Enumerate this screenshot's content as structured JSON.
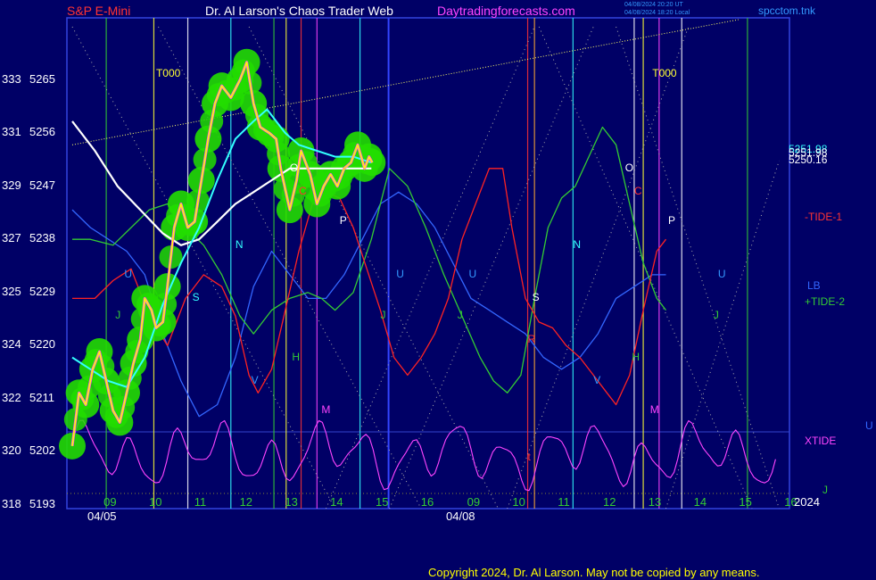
{
  "header": {
    "symbol": "S&P E-Mini",
    "author": "Dr. Al Larson's Chaos Trader Web",
    "site": "Daytradingforecasts.com",
    "file": "spcctom.tnk",
    "stamp1": "04/08/2024 20:20 UT",
    "stamp2": "04/08/2024 18:20 Local"
  },
  "copyright": "Copyright 2024, Dr. Al Larson. May not be copied by any means.",
  "year_label": "2024",
  "colors": {
    "bg": "#000066",
    "price": "#ffff00",
    "glow": "#22dd00",
    "ma_fast": "#33ffff",
    "ma_slow": "#ffffff",
    "tide1": "#ff2222",
    "tide2": "#33cc33",
    "lb": "#3366ff",
    "xtide": "#ff44ff",
    "grid": "#3344cc"
  },
  "chart_data": {
    "type": "line",
    "ylim": [
      5193,
      5274
    ],
    "y_ticks": [
      {
        "left": "318",
        "price": "5193"
      },
      {
        "left": "320",
        "price": "5202"
      },
      {
        "left": "322",
        "price": "5211"
      },
      {
        "left": "324",
        "price": "5220"
      },
      {
        "left": "325",
        "price": "5229"
      },
      {
        "left": "327",
        "price": "5238"
      },
      {
        "left": "329",
        "price": "5247"
      },
      {
        "left": "331",
        "price": "5256"
      },
      {
        "left": "333",
        "price": "5265"
      }
    ],
    "x_hour_ticks": [
      "09",
      "10",
      "11",
      "12",
      "13",
      "14",
      "15",
      "16",
      "09",
      "10",
      "11",
      "12",
      "13",
      "14",
      "15",
      "16"
    ],
    "x_dates": [
      "04/05",
      "04/08"
    ],
    "right_values": [
      "5251.98",
      "5251.98",
      "5250.16"
    ],
    "series": [
      {
        "name": "-TIDE-1",
        "color": "#ff2222"
      },
      {
        "name": "LB",
        "color": "#3366ff"
      },
      {
        "name": "+TIDE-2",
        "color": "#33cc33"
      },
      {
        "name": "XTIDE",
        "color": "#ff44ff"
      }
    ],
    "price_points": [
      [
        0,
        5203
      ],
      [
        0.15,
        5212
      ],
      [
        0.3,
        5210
      ],
      [
        0.45,
        5216
      ],
      [
        0.6,
        5219
      ],
      [
        0.75,
        5214
      ],
      [
        0.9,
        5209
      ],
      [
        1.05,
        5207
      ],
      [
        1.2,
        5212
      ],
      [
        1.35,
        5217
      ],
      [
        1.5,
        5221
      ],
      [
        1.6,
        5228
      ],
      [
        1.75,
        5226
      ],
      [
        1.85,
        5223
      ],
      [
        2.0,
        5224
      ],
      [
        2.1,
        5230
      ],
      [
        2.25,
        5240
      ],
      [
        2.4,
        5244
      ],
      [
        2.55,
        5240
      ],
      [
        2.7,
        5241
      ],
      [
        2.85,
        5248
      ],
      [
        3.0,
        5255
      ],
      [
        3.15,
        5261
      ],
      [
        3.3,
        5264
      ],
      [
        3.5,
        5262
      ],
      [
        3.7,
        5265
      ],
      [
        3.85,
        5268
      ],
      [
        4.0,
        5261
      ],
      [
        4.15,
        5257
      ],
      [
        4.35,
        5256
      ],
      [
        4.5,
        5255
      ],
      [
        4.6,
        5250
      ],
      [
        4.8,
        5243
      ],
      [
        4.95,
        5248
      ],
      [
        5.05,
        5253
      ],
      [
        5.25,
        5249
      ],
      [
        5.4,
        5244
      ],
      [
        5.55,
        5247
      ],
      [
        5.7,
        5249
      ],
      [
        5.85,
        5247
      ],
      [
        6.0,
        5250
      ],
      [
        6.15,
        5251
      ],
      [
        6.3,
        5254
      ],
      [
        6.45,
        5250
      ],
      [
        6.55,
        5252
      ],
      [
        6.62,
        5251
      ]
    ],
    "ma_fast_points": [
      [
        0,
        5218
      ],
      [
        0.4,
        5216
      ],
      [
        0.8,
        5214
      ],
      [
        1.2,
        5213
      ],
      [
        1.6,
        5218
      ],
      [
        2.0,
        5227
      ],
      [
        2.4,
        5234
      ],
      [
        2.8,
        5240
      ],
      [
        3.2,
        5248
      ],
      [
        3.6,
        5255
      ],
      [
        4.0,
        5258
      ],
      [
        4.3,
        5260
      ],
      [
        4.7,
        5256
      ],
      [
        5.0,
        5254
      ],
      [
        5.4,
        5253
      ],
      [
        5.8,
        5252
      ],
      [
        6.2,
        5252
      ],
      [
        6.6,
        5251
      ]
    ],
    "ma_slow_points": [
      [
        0,
        5258
      ],
      [
        0.5,
        5253
      ],
      [
        1.0,
        5247
      ],
      [
        1.5,
        5243
      ],
      [
        2.0,
        5239
      ],
      [
        2.4,
        5237
      ],
      [
        2.8,
        5238
      ],
      [
        3.2,
        5241
      ],
      [
        3.6,
        5244
      ],
      [
        4.0,
        5246
      ],
      [
        4.4,
        5248
      ],
      [
        4.8,
        5250
      ],
      [
        5.2,
        5250
      ],
      [
        5.6,
        5250
      ],
      [
        6.0,
        5250
      ],
      [
        6.6,
        5250
      ]
    ],
    "tide1_points": [
      [
        0,
        5228
      ],
      [
        0.5,
        5228
      ],
      [
        0.9,
        5231
      ],
      [
        1.3,
        5233
      ],
      [
        1.7,
        5225
      ],
      [
        2.1,
        5220
      ],
      [
        2.5,
        5228
      ],
      [
        2.9,
        5232
      ],
      [
        3.3,
        5230
      ],
      [
        3.6,
        5225
      ],
      [
        3.9,
        5215
      ],
      [
        4.1,
        5212
      ],
      [
        4.4,
        5216
      ],
      [
        4.7,
        5226
      ],
      [
        5.0,
        5236
      ],
      [
        5.3,
        5244
      ],
      [
        5.6,
        5246
      ],
      [
        5.9,
        5245
      ],
      [
        6.2,
        5240
      ],
      [
        6.5,
        5233
      ],
      [
        6.8,
        5226
      ],
      [
        7.1,
        5218
      ],
      [
        7.4,
        5215
      ],
      [
        7.7,
        5218
      ],
      [
        8.0,
        5222
      ],
      [
        8.3,
        5228
      ],
      [
        8.6,
        5238
      ],
      [
        8.9,
        5244
      ],
      [
        9.2,
        5250
      ],
      [
        9.5,
        5250
      ],
      [
        9.7,
        5240
      ],
      [
        10.0,
        5228
      ],
      [
        10.3,
        5224
      ],
      [
        10.6,
        5223
      ],
      [
        10.9,
        5220
      ],
      [
        11.2,
        5218
      ],
      [
        11.5,
        5215
      ],
      [
        11.8,
        5212
      ],
      [
        12.0,
        5210
      ],
      [
        12.3,
        5215
      ],
      [
        12.6,
        5226
      ],
      [
        12.9,
        5236
      ],
      [
        13.1,
        5238
      ]
    ],
    "tide2_points": [
      [
        0,
        5238
      ],
      [
        0.4,
        5238
      ],
      [
        0.9,
        5237
      ],
      [
        1.3,
        5240
      ],
      [
        1.7,
        5243
      ],
      [
        2.1,
        5244
      ],
      [
        2.5,
        5240
      ],
      [
        2.9,
        5237
      ],
      [
        3.3,
        5232
      ],
      [
        3.7,
        5225
      ],
      [
        4.0,
        5222
      ],
      [
        4.4,
        5226
      ],
      [
        4.8,
        5228
      ],
      [
        5.2,
        5229
      ],
      [
        5.5,
        5228
      ],
      [
        5.8,
        5226
      ],
      [
        6.2,
        5229
      ],
      [
        6.6,
        5238
      ],
      [
        7.0,
        5250
      ],
      [
        7.4,
        5247
      ],
      [
        7.8,
        5240
      ],
      [
        8.2,
        5232
      ],
      [
        8.6,
        5225
      ],
      [
        9.0,
        5218
      ],
      [
        9.3,
        5214
      ],
      [
        9.6,
        5212
      ],
      [
        9.9,
        5215
      ],
      [
        10.2,
        5228
      ],
      [
        10.5,
        5240
      ],
      [
        10.8,
        5245
      ],
      [
        11.1,
        5247
      ],
      [
        11.4,
        5252
      ],
      [
        11.7,
        5257
      ],
      [
        12.0,
        5254
      ],
      [
        12.3,
        5244
      ],
      [
        12.6,
        5234
      ],
      [
        12.9,
        5228
      ],
      [
        13.1,
        5226
      ]
    ],
    "lb_points": [
      [
        0,
        5243
      ],
      [
        0.4,
        5240
      ],
      [
        0.8,
        5238
      ],
      [
        1.2,
        5236
      ],
      [
        1.6,
        5232
      ],
      [
        2.0,
        5222
      ],
      [
        2.4,
        5214
      ],
      [
        2.8,
        5208
      ],
      [
        3.2,
        5210
      ],
      [
        3.6,
        5218
      ],
      [
        4.0,
        5230
      ],
      [
        4.4,
        5236
      ],
      [
        4.8,
        5232
      ],
      [
        5.2,
        5228
      ],
      [
        5.6,
        5228
      ],
      [
        6.0,
        5232
      ],
      [
        6.4,
        5238
      ],
      [
        6.8,
        5244
      ],
      [
        7.2,
        5246
      ],
      [
        7.6,
        5244
      ],
      [
        8.0,
        5240
      ],
      [
        8.4,
        5234
      ],
      [
        8.8,
        5228
      ],
      [
        9.2,
        5226
      ],
      [
        9.6,
        5224
      ],
      [
        10.0,
        5222
      ],
      [
        10.4,
        5218
      ],
      [
        10.8,
        5216
      ],
      [
        11.2,
        5218
      ],
      [
        11.6,
        5222
      ],
      [
        12.0,
        5228
      ],
      [
        12.4,
        5230
      ],
      [
        12.8,
        5232
      ],
      [
        13.1,
        5232
      ]
    ],
    "xtide_range": [
      5195,
      5208
    ],
    "annotations": [
      {
        "t": "T000",
        "x": 1.85,
        "y": 5266,
        "color": "#ffff33"
      },
      {
        "t": "T000",
        "x": 12.8,
        "y": 5266,
        "color": "#ffff33"
      },
      {
        "t": "O",
        "x": 4.8,
        "y": 5250,
        "color": "#ffffff"
      },
      {
        "t": "C",
        "x": 5.0,
        "y": 5246,
        "color": "#ff3333"
      },
      {
        "t": "P",
        "x": 5.9,
        "y": 5241,
        "color": "#ffffff"
      },
      {
        "t": "N",
        "x": 3.6,
        "y": 5237,
        "color": "#33ffff"
      },
      {
        "t": "S",
        "x": 2.65,
        "y": 5228,
        "color": "#33ffff"
      },
      {
        "t": "U",
        "x": 1.15,
        "y": 5232,
        "color": "#3399ff"
      },
      {
        "t": "J",
        "x": 0.95,
        "y": 5225,
        "color": "#33cc33"
      },
      {
        "t": "V",
        "x": 3.95,
        "y": 5214,
        "color": "#3399ff"
      },
      {
        "t": "H",
        "x": 4.85,
        "y": 5218,
        "color": "#33cc33"
      },
      {
        "t": "M",
        "x": 5.5,
        "y": 5209,
        "color": "#ff44ff"
      },
      {
        "t": "U",
        "x": 7.15,
        "y": 5232,
        "color": "#3399ff"
      },
      {
        "t": "U",
        "x": 8.75,
        "y": 5232,
        "color": "#3399ff"
      },
      {
        "t": "J",
        "x": 6.8,
        "y": 5225,
        "color": "#33cc33"
      },
      {
        "t": "J",
        "x": 8.5,
        "y": 5225,
        "color": "#33cc33"
      },
      {
        "t": "S",
        "x": 10.15,
        "y": 5228,
        "color": "#ffffff"
      },
      {
        "t": "R",
        "x": 10.05,
        "y": 5221,
        "color": "#ff3333"
      },
      {
        "t": "N",
        "x": 11.05,
        "y": 5237,
        "color": "#33ffff"
      },
      {
        "t": "O",
        "x": 12.2,
        "y": 5250,
        "color": "#ffffff"
      },
      {
        "t": "C",
        "x": 12.4,
        "y": 5246,
        "color": "#ff3333"
      },
      {
        "t": "P",
        "x": 13.15,
        "y": 5241,
        "color": "#ffffff"
      },
      {
        "t": "H",
        "x": 12.35,
        "y": 5218,
        "color": "#33cc33"
      },
      {
        "t": "M",
        "x": 12.75,
        "y": 5209,
        "color": "#ff44ff"
      },
      {
        "t": "V",
        "x": 11.5,
        "y": 5214,
        "color": "#3399ff"
      },
      {
        "t": "U",
        "x": 14.25,
        "y": 5232,
        "color": "#3399ff"
      },
      {
        "t": "J",
        "x": 14.15,
        "y": 5225,
        "color": "#33cc33"
      },
      {
        "t": "t",
        "x": 10.05,
        "y": 5201,
        "color": "#ff3333"
      }
    ],
    "legend": [
      {
        "t": "-TIDE-1",
        "color": "#ff3333"
      },
      {
        "t": "LB",
        "color": "#3366ff"
      },
      {
        "t": "+TIDE-2",
        "color": "#33cc33"
      },
      {
        "t": "XTIDE",
        "color": "#ff44ff"
      }
    ],
    "edge_labels": [
      {
        "t": "U",
        "color": "#3366ff"
      },
      {
        "t": "J",
        "color": "#33cc33"
      }
    ]
  }
}
